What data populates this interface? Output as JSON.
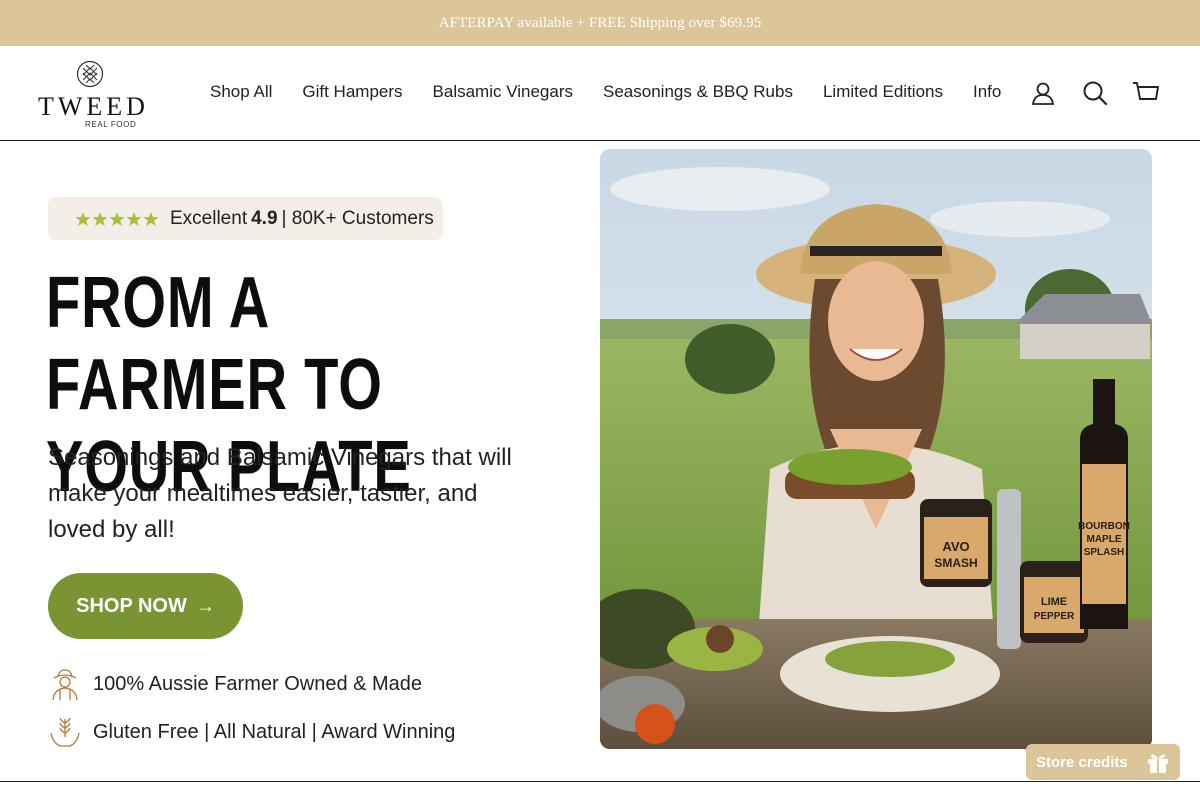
{
  "announcement": "AFTERPAY available + FREE Shipping over $69.95",
  "brand": {
    "name": "TWEED",
    "tagline": "REAL FOOD"
  },
  "nav": [
    "Shop All",
    "Gift Hampers",
    "Balsamic Vinegars",
    "Seasonings & BBQ Rubs",
    "Limited Editions",
    "Info"
  ],
  "header_icons": [
    "account-icon",
    "search-icon",
    "cart-icon"
  ],
  "rating": {
    "stars": 5,
    "label": "Excellent",
    "score": "4.9",
    "customers": "| 80K+ Customers"
  },
  "hero": {
    "headline_line1": "FROM A FARMER TO",
    "headline_line2": "YOUR PLATE",
    "subheadline": "Seasonings and Balsamic Vinegars that will make your mealtimes easier, tastier, and loved by all!",
    "cta": "SHOP NOW",
    "image_products": {
      "jar1_line1": "AVO",
      "jar1_line2": "SMASH",
      "jar2_line1": "LIME",
      "jar2_line2": "PEPPER",
      "bottle_line1": "BOURBON",
      "bottle_line2": "MAPLE",
      "bottle_line3": "SPLASH"
    }
  },
  "features": [
    {
      "icon": "farmer-icon",
      "text": "100% Aussie Farmer Owned & Made"
    },
    {
      "icon": "wheat-hand-icon",
      "text": "Gluten Free | All Natural | Award Winning"
    }
  ],
  "store_credits": "Store credits",
  "colors": {
    "announcement_bg": "#dcc699",
    "cta_green": "#7a9434",
    "rating_bg": "#f3efe8",
    "star": "#a6c23a"
  }
}
